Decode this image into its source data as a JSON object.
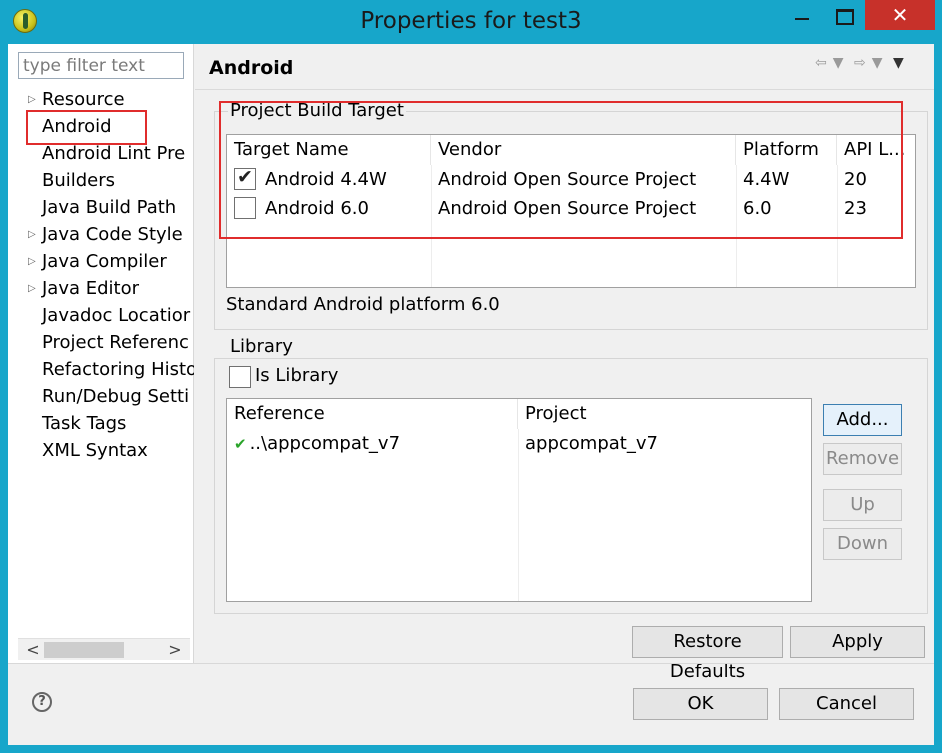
{
  "window": {
    "title": "Properties for test3",
    "close_glyph": "✕"
  },
  "filter": {
    "placeholder": "type filter text"
  },
  "tree": {
    "items": [
      {
        "label": "Resource",
        "expandable": true
      },
      {
        "label": "Android",
        "expandable": false,
        "selected": true
      },
      {
        "label": "Android Lint Pre",
        "expandable": false
      },
      {
        "label": "Builders",
        "expandable": false
      },
      {
        "label": "Java Build Path",
        "expandable": false
      },
      {
        "label": "Java Code Style",
        "expandable": true
      },
      {
        "label": "Java Compiler",
        "expandable": true
      },
      {
        "label": "Java Editor",
        "expandable": true
      },
      {
        "label": "Javadoc Locatior",
        "expandable": false
      },
      {
        "label": "Project Referenc",
        "expandable": false
      },
      {
        "label": "Refactoring Histo",
        "expandable": false
      },
      {
        "label": "Run/Debug Setti",
        "expandable": false
      },
      {
        "label": "Task Tags",
        "expandable": false
      },
      {
        "label": "XML Syntax",
        "expandable": false
      }
    ],
    "arrow_glyph": "▷",
    "scroll_left": "<",
    "scroll_right": ">"
  },
  "pane": {
    "title": "Android"
  },
  "build_target": {
    "group_label": "Project Build Target",
    "columns": [
      "Target Name",
      "Vendor",
      "Platform",
      "API L..."
    ],
    "rows": [
      {
        "checked": true,
        "name": "Android 4.4W",
        "vendor": "Android Open Source Project",
        "platform": "4.4W",
        "api": "20"
      },
      {
        "checked": false,
        "name": "Android 6.0",
        "vendor": "Android Open Source Project",
        "platform": "6.0",
        "api": "23"
      }
    ],
    "description": "Standard Android platform 6.0"
  },
  "library": {
    "group_label": "Library",
    "is_library_label": "Is Library",
    "is_library_checked": false,
    "columns": [
      "Reference",
      "Project"
    ],
    "rows": [
      {
        "reference": "..\\appcompat_v7",
        "project": "appcompat_v7",
        "ok": true
      }
    ],
    "buttons": {
      "add": "Add...",
      "remove": "Remove",
      "up": "Up",
      "down": "Down"
    }
  },
  "actions": {
    "restore_defaults": "Restore Defaults",
    "apply": "Apply",
    "ok": "OK",
    "cancel": "Cancel",
    "help_glyph": "?"
  },
  "colors": {
    "title_bar": "#17a6ca",
    "close_button": "#c7312a",
    "highlight_box": "#e02c2c",
    "ok_check": "#2aa42a"
  }
}
